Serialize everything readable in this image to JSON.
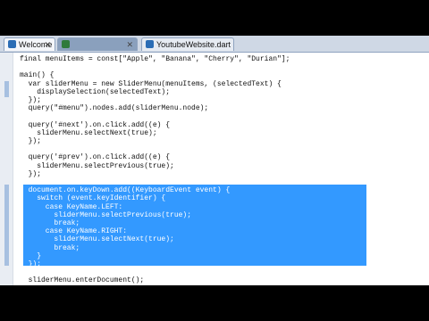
{
  "tabs": [
    {
      "label": "Welcome",
      "icon": "dart-file-icon"
    },
    {
      "label": "",
      "icon": "dart-file-icon"
    },
    {
      "label": "YoutubeWebsite.dart",
      "icon": "dart-file-icon"
    }
  ],
  "code": {
    "lines": [
      "final menuItems = const[\"Apple\", \"Banana\", \"Cherry\", \"Durian\"];",
      "",
      "main() {",
      "  var sliderMenu = new SliderMenu(menuItems, (selectedText) {",
      "    displaySelection(selectedText);",
      "  });",
      "  query(\"#menu\").nodes.add(sliderMenu.node);",
      "",
      "  query('#next').on.click.add((e) {",
      "    sliderMenu.selectNext(true);",
      "  });",
      "",
      "  query('#prev').on.click.add((e) {",
      "    sliderMenu.selectPrevious(true);",
      "  });",
      "",
      "  document.on.keyDown.add((KeyboardEvent event) {",
      "    switch (event.keyIdentifier) {",
      "      case KeyName.LEFT:",
      "        sliderMenu.selectPrevious(true);",
      "        break;",
      "      case KeyName.RIGHT:",
      "        sliderMenu.selectNext(true);",
      "        break;",
      "    }",
      "  });",
      "",
      "  sliderMenu.enterDocument();"
    ]
  },
  "colors": {
    "selection": "#3399ff",
    "tabbar": "#cfd8e5"
  }
}
